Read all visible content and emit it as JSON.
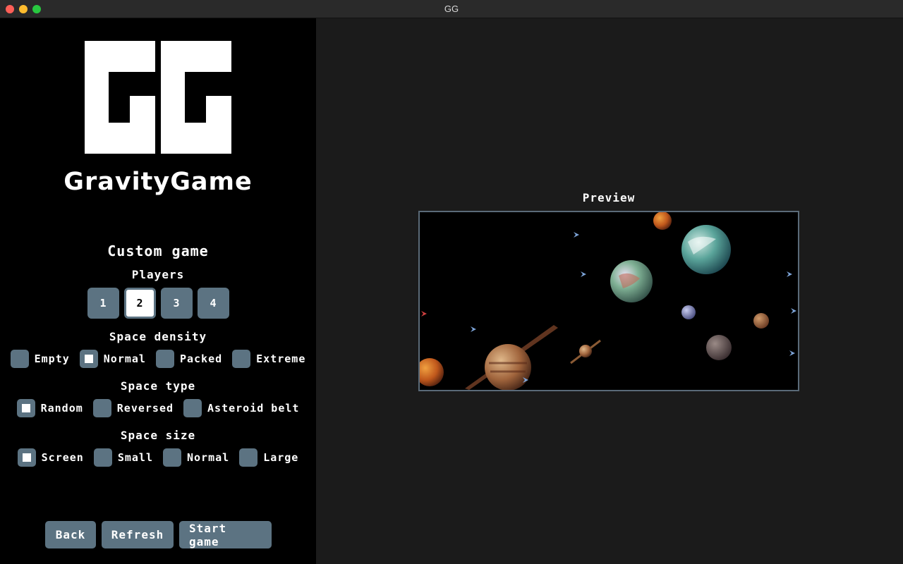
{
  "window": {
    "title": "GG"
  },
  "logo": {
    "mark": "GG",
    "name": "GravityGame"
  },
  "menu": {
    "title": "Custom game",
    "players": {
      "label": "Players",
      "options": [
        "1",
        "2",
        "3",
        "4"
      ],
      "selected": "2"
    },
    "space_density": {
      "label": "Space density",
      "options": [
        "Empty",
        "Normal",
        "Packed",
        "Extreme"
      ],
      "selected": "Normal"
    },
    "space_type": {
      "label": "Space type",
      "options": [
        "Random",
        "Reversed",
        "Asteroid belt"
      ],
      "selected": "Random"
    },
    "space_size": {
      "label": "Space size",
      "options": [
        "Screen",
        "Small",
        "Normal",
        "Large"
      ],
      "selected": "Screen"
    },
    "buttons": {
      "back": "Back",
      "refresh": "Refresh",
      "start": "Start game"
    }
  },
  "preview": {
    "label": "Preview"
  },
  "colors": {
    "button": "#5c7382",
    "panel": "#000000",
    "background": "#1b1b1b",
    "preview_border": "#5a6a78"
  }
}
